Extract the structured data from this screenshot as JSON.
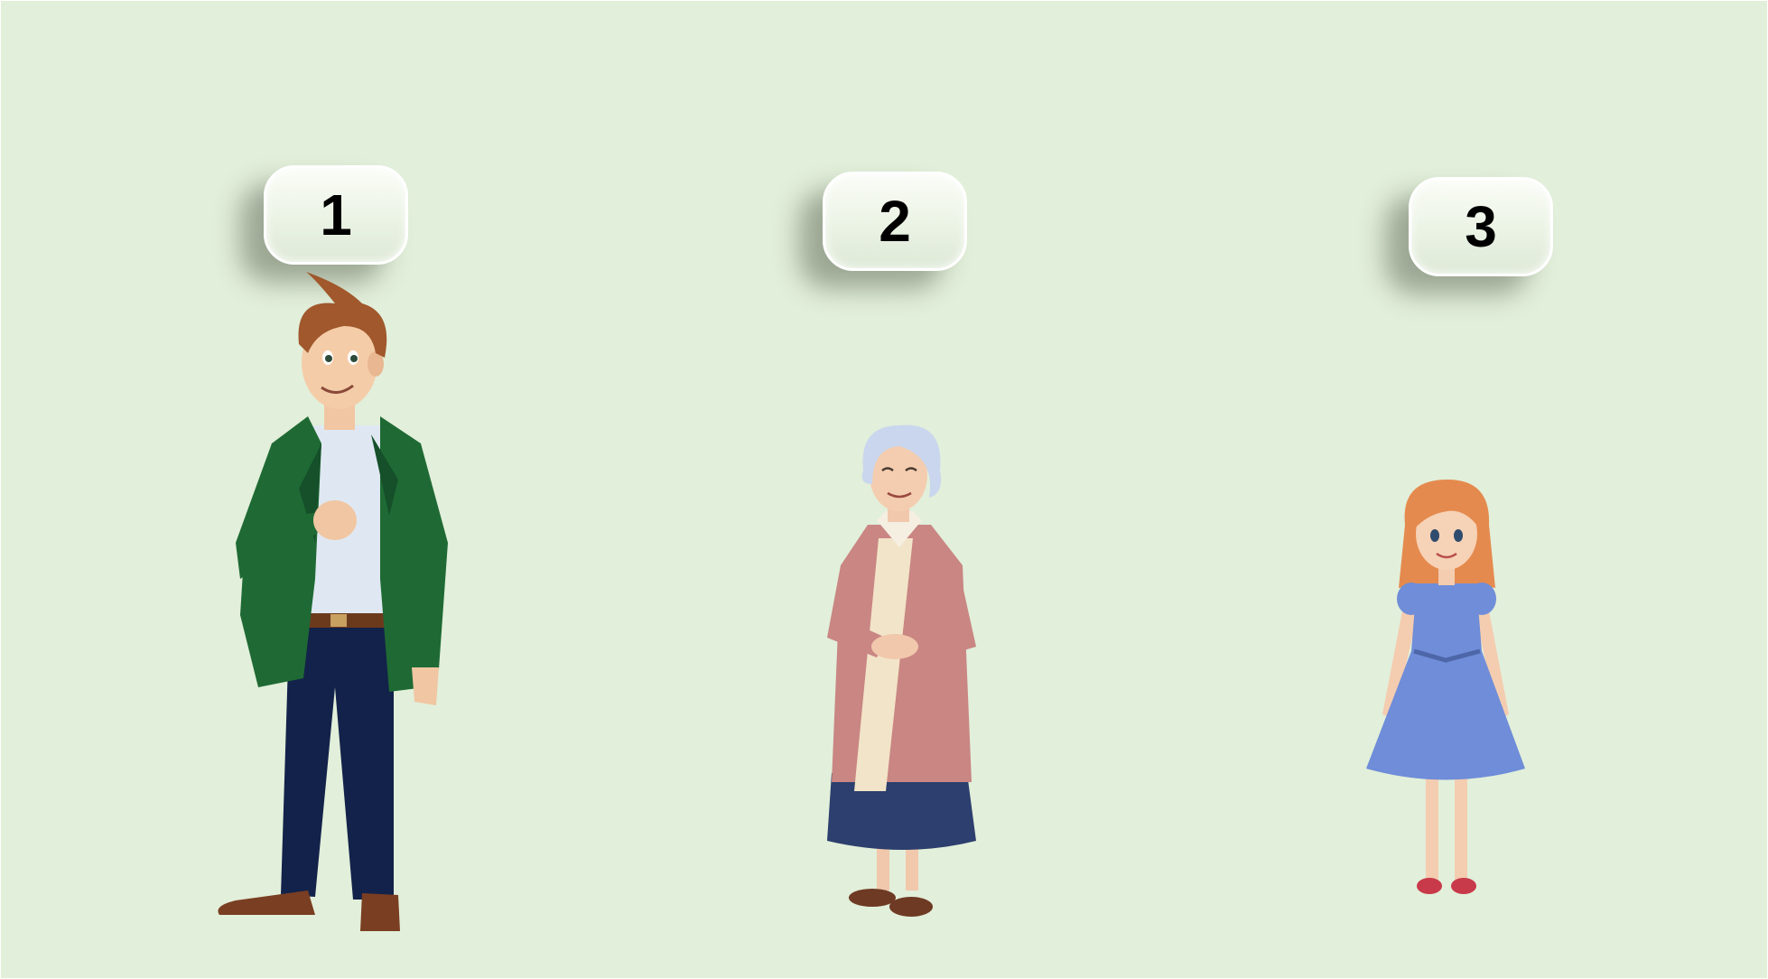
{
  "slide": {
    "background_color": "#e2efda",
    "badges": [
      {
        "label": "1"
      },
      {
        "label": "2"
      },
      {
        "label": "3"
      }
    ],
    "characters": [
      {
        "icon": "young-man-green-jacket-illustration"
      },
      {
        "icon": "grandmother-pink-coat-illustration"
      },
      {
        "icon": "girl-blue-dress-illustration"
      }
    ]
  }
}
